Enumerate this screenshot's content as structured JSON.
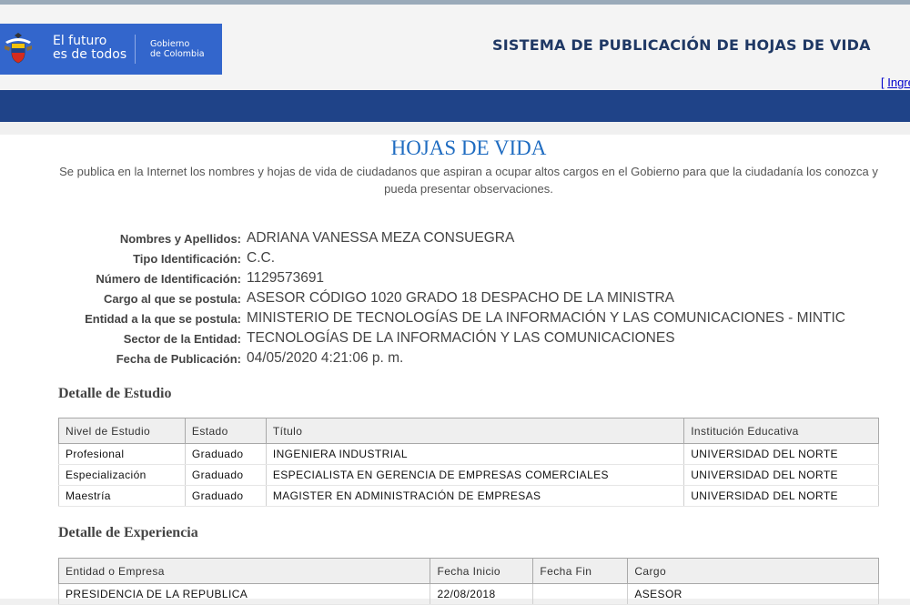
{
  "header": {
    "logo": {
      "main_line1": "El futuro",
      "main_line2": "es de todos",
      "gov_line1": "Gobierno",
      "gov_line2": "de Colombia"
    },
    "system_title": "SISTEMA DE PUBLICACIÓN DE HOJAS DE VIDA",
    "login_bracket": "[",
    "login_link": "Ingresar"
  },
  "main": {
    "title": "HOJAS DE VIDA",
    "intro": "Se publica en la Internet los nombres y hojas de vida de ciudadanos que aspiran a ocupar altos cargos en el Gobierno para que la ciudadanía los conozca y pueda presentar observaciones.",
    "fields": [
      {
        "label": "Nombres y Apellidos:",
        "value": "ADRIANA VANESSA MEZA CONSUEGRA"
      },
      {
        "label": "Tipo Identificación:",
        "value": "C.C."
      },
      {
        "label": "Número de Identificación:",
        "value": "1129573691"
      },
      {
        "label": "Cargo al que se postula:",
        "value": "ASESOR CÓDIGO 1020 GRADO 18 DESPACHO DE LA MINISTRA"
      },
      {
        "label": "Entidad a la que se postula:",
        "value": "MINISTERIO DE TECNOLOGÍAS DE LA INFORMACIÓN Y LAS COMUNICACIONES - MINTIC"
      },
      {
        "label": "Sector de la Entidad:",
        "value": "TECNOLOGÍAS DE LA INFORMACIÓN Y LAS COMUNICACIONES"
      },
      {
        "label": "Fecha de Publicación:",
        "value": "04/05/2020 4:21:06 p. m."
      }
    ],
    "education": {
      "title": "Detalle de Estudio",
      "headers": [
        "Nivel de Estudio",
        "Estado",
        "Título",
        "Institución Educativa"
      ],
      "rows": [
        [
          "Profesional",
          "Graduado",
          "INGENIERA INDUSTRIAL",
          "UNIVERSIDAD DEL NORTE"
        ],
        [
          "Especialización",
          "Graduado",
          "ESPECIALISTA EN GERENCIA DE EMPRESAS COMERCIALES",
          "UNIVERSIDAD DEL NORTE"
        ],
        [
          "Maestría",
          "Graduado",
          "MAGISTER EN ADMINISTRACIÓN DE EMPRESAS",
          "UNIVERSIDAD DEL NORTE"
        ]
      ]
    },
    "experience": {
      "title": "Detalle de Experiencia",
      "headers": [
        "Entidad o Empresa",
        "Fecha Inicio",
        "Fecha Fin",
        "Cargo"
      ],
      "rows": [
        [
          "PRESIDENCIA DE LA REPUBLICA",
          "22/08/2018",
          "",
          "ASESOR"
        ]
      ]
    }
  },
  "colors": {
    "brand_blue": "#3366cc",
    "nav_bar": "#1f4388",
    "title_blue": "#1f6cc1",
    "system_title": "#1f3864"
  }
}
